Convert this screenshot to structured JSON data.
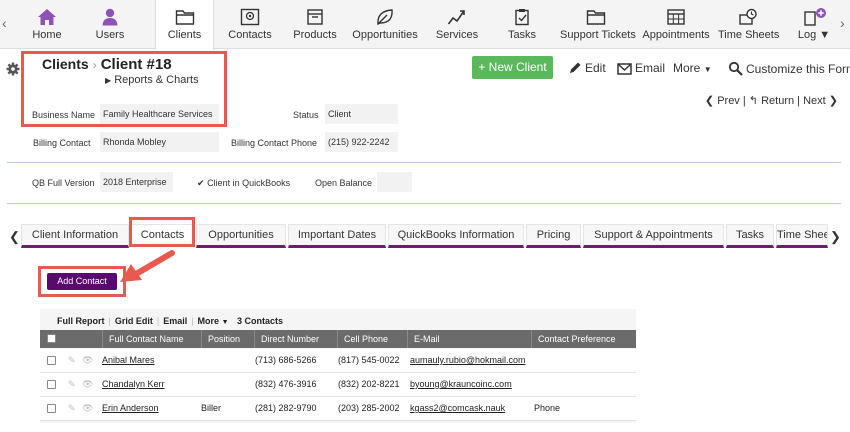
{
  "nav": {
    "items": [
      {
        "label": "Home",
        "icon": "home-icon"
      },
      {
        "label": "Users",
        "icon": "user-icon"
      },
      {
        "label": "Clients",
        "icon": "folder-icon"
      },
      {
        "label": "Contacts",
        "icon": "contact-card-icon"
      },
      {
        "label": "Products",
        "icon": "box-icon"
      },
      {
        "label": "Opportunities",
        "icon": "leaf-icon"
      },
      {
        "label": "Services",
        "icon": "trend-icon"
      },
      {
        "label": "Tasks",
        "icon": "clipboard-icon"
      },
      {
        "label": "Support Tickets",
        "icon": "folder-icon"
      },
      {
        "label": "Appointments",
        "icon": "calendar-icon"
      },
      {
        "label": "Time Sheets",
        "icon": "timesheet-icon"
      },
      {
        "label": "Log",
        "icon": "log-icon"
      }
    ],
    "active_index": 2,
    "accent": "#8e52b9"
  },
  "header": {
    "crumb_root": "Clients",
    "crumb_current": "Client #18",
    "reports_link": "Reports & Charts",
    "new_client": "+ New Client",
    "edit": "Edit",
    "email": "Email",
    "more": "More",
    "customize": "Customize this Form"
  },
  "pager": {
    "prev": "Prev",
    "return": "Return",
    "next": "Next"
  },
  "fields": {
    "business_name_label": "Business Name",
    "business_name": "Family Healthcare Services",
    "status_label": "Status",
    "status": "Client",
    "billing_contact_label": "Billing Contact",
    "billing_contact": "Rhonda Mobley",
    "billing_phone_label": "Billing Contact Phone",
    "billing_phone": "(215) 922-2242",
    "qb_version_label": "QB Full Version",
    "qb_version": "2018 Enterprise",
    "in_qb_label": "Client in QuickBooks",
    "open_balance_label": "Open Balance"
  },
  "tabs": [
    "Client Information",
    "Contacts",
    "Opportunities",
    "Important Dates",
    "QuickBooks Information",
    "Pricing",
    "Support & Appointments",
    "Tasks",
    "Time Sheets"
  ],
  "add_contact": "Add Contact",
  "grid": {
    "toolbar": {
      "full_report": "Full Report",
      "grid_edit": "Grid Edit",
      "email": "Email",
      "more": "More",
      "count": "3 Contacts"
    },
    "columns": [
      "Full Contact Name",
      "Position",
      "Direct Number",
      "Cell Phone",
      "E-Mail",
      "Contact Preference"
    ],
    "rows": [
      {
        "name": "Anibal Mares",
        "position": "",
        "direct": "(713) 686-5266",
        "cell": "(817) 545-0022",
        "email": "aumauly.rubio@hokmail.com",
        "pref": ""
      },
      {
        "name": "Chandalyn Kerr",
        "position": "",
        "direct": "(832) 476-3916",
        "cell": "(832) 202-8221",
        "email": "byoung@krauncoinc.com",
        "pref": ""
      },
      {
        "name": "Erin Anderson",
        "position": "Biller",
        "direct": "(281) 282-9790",
        "cell": "(203) 285-2002",
        "email": "kgass2@comcask.nauk",
        "pref": "Phone"
      }
    ]
  }
}
